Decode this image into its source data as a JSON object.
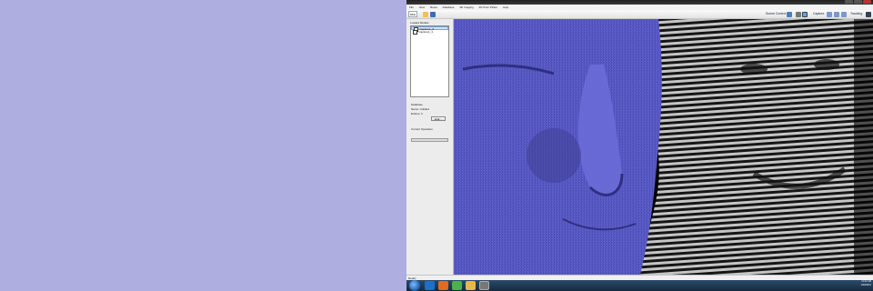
{
  "menu": [
    "File",
    "View",
    "Reset",
    "Database",
    "3D Imaging",
    "3D Point Picker",
    "Help"
  ],
  "toolbar": {
    "mode_label": "Mfile",
    "scene_control_label": "Scene Control",
    "capture_label": "Capture",
    "tracking_label": "Tracking"
  },
  "left_panel": {
    "title": "Loaded Models",
    "models": [
      {
        "label": "Capture1_0",
        "selected": true
      },
      {
        "label": "Capture1_1",
        "selected": false
      }
    ],
    "database_label": "Database",
    "name_label": "Name: Untitled",
    "entries_label": "Entries: 0",
    "button_label": "Edit...",
    "operation_label": "Current Operation",
    "progress": 0.0
  },
  "status": {
    "text": "Ready"
  },
  "tray": {
    "time": "11:22 AM",
    "date": "1/30/2012"
  },
  "colors": {
    "desktop_bg": "#aeaee0",
    "mesh": "#5c5ccc",
    "accent": "#3b78c9"
  },
  "icons": [
    "open-folder-icon",
    "save-icon",
    "pointer-icon",
    "camera-icon",
    "tracking-icon"
  ]
}
